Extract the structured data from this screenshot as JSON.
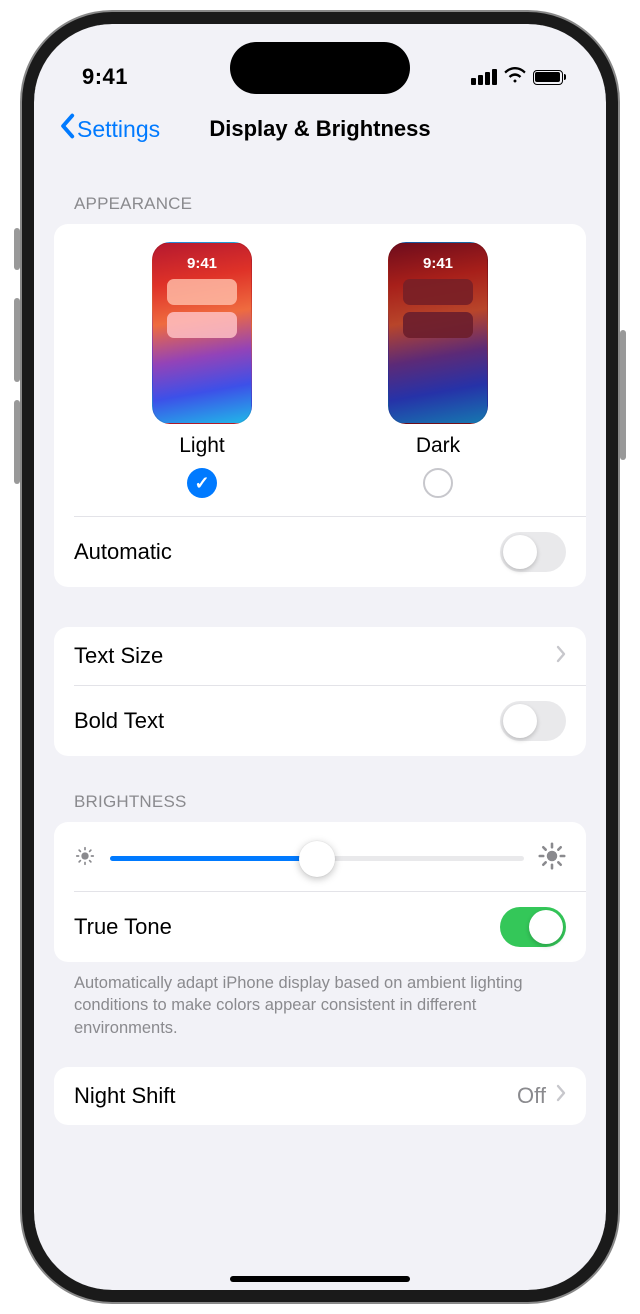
{
  "status": {
    "time": "9:41"
  },
  "nav": {
    "back": "Settings",
    "title": "Display & Brightness"
  },
  "appearance": {
    "header": "APPEARANCE",
    "light_label": "Light",
    "dark_label": "Dark",
    "preview_time": "9:41",
    "selected": "light",
    "automatic_label": "Automatic",
    "automatic_on": false
  },
  "text": {
    "text_size_label": "Text Size",
    "bold_label": "Bold Text",
    "bold_on": false
  },
  "brightness": {
    "header": "BRIGHTNESS",
    "value_pct": 50,
    "true_tone_label": "True Tone",
    "true_tone_on": true,
    "true_tone_desc": "Automatically adapt iPhone display based on ambient lighting conditions to make colors appear consistent in different environments."
  },
  "night_shift": {
    "label": "Night Shift",
    "value": "Off"
  }
}
